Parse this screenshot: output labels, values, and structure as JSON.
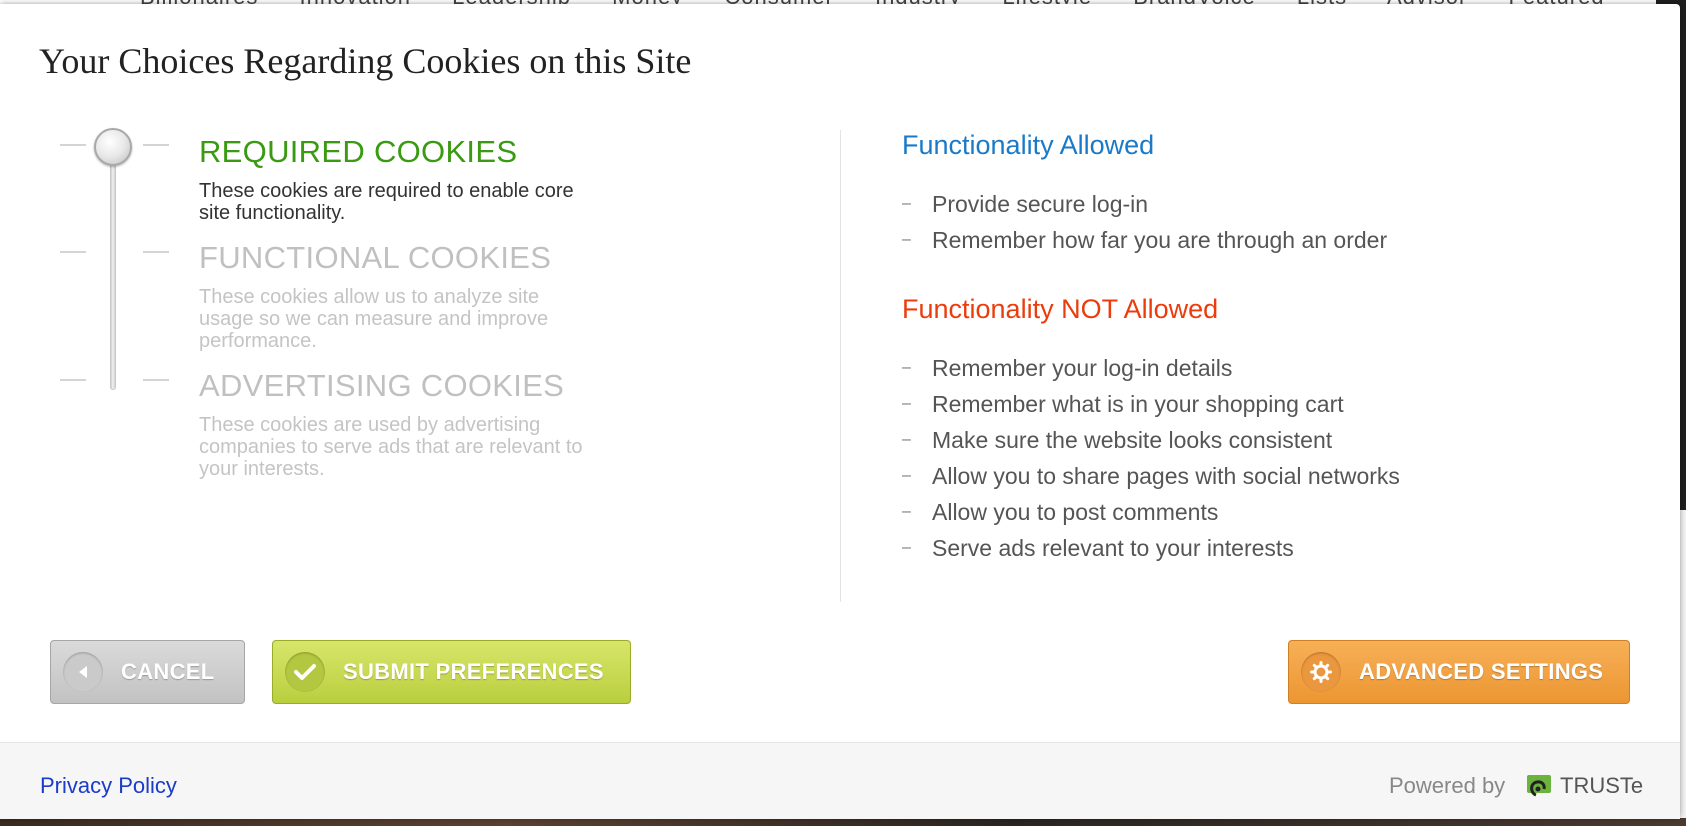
{
  "background": {
    "nav_items": [
      "Billionaires",
      "Innovation",
      "Leadership",
      "Money",
      "Consumer",
      "Industry",
      "Lifestyle",
      "BrandVoice",
      "Lists",
      "Advisor",
      "Featured"
    ]
  },
  "modal": {
    "title": "Your Choices Regarding Cookies on this Site",
    "categories": [
      {
        "heading": "REQUIRED COOKIES",
        "description": "These cookies are required to enable core site functionality.",
        "state": "active"
      },
      {
        "heading": "FUNCTIONAL COOKIES",
        "description": "These cookies allow us to analyze site usage so we can measure and improve performance.",
        "state": "inactive"
      },
      {
        "heading": "ADVERTISING COOKIES",
        "description": "These cookies are used by advertising companies to serve ads that are relevant to your interests.",
        "state": "inactive"
      }
    ],
    "slider_level": "REQUIRED COOKIES",
    "allowed": {
      "heading": "Functionality Allowed",
      "items": [
        "Provide secure log-in",
        "Remember how far you are through an order"
      ]
    },
    "not_allowed": {
      "heading": "Functionality NOT Allowed",
      "items": [
        "Remember your log-in details",
        "Remember what is in your shopping cart",
        "Make sure the website looks consistent",
        "Allow you to share pages with social networks",
        "Allow you to post comments",
        "Serve ads relevant to your interests"
      ]
    },
    "buttons": {
      "cancel": "CANCEL",
      "submit": "SUBMIT PREFERENCES",
      "advanced": "ADVANCED SETTINGS"
    },
    "footer": {
      "privacy_link": "Privacy Policy",
      "powered_by": "Powered by",
      "brand": "TRUSTe"
    }
  },
  "colors": {
    "active_green": "#3a9a12",
    "allowed_blue": "#1a7ac8",
    "not_allowed_red": "#ec3c0c",
    "cancel_gray": "#c8c8c8",
    "submit_green": "#c6d94e",
    "advanced_orange": "#f0a040"
  },
  "icons": {
    "cancel": "arrow-left-icon",
    "submit": "check-icon",
    "advanced": "gear-icon",
    "brand": "truste-logo-icon"
  }
}
